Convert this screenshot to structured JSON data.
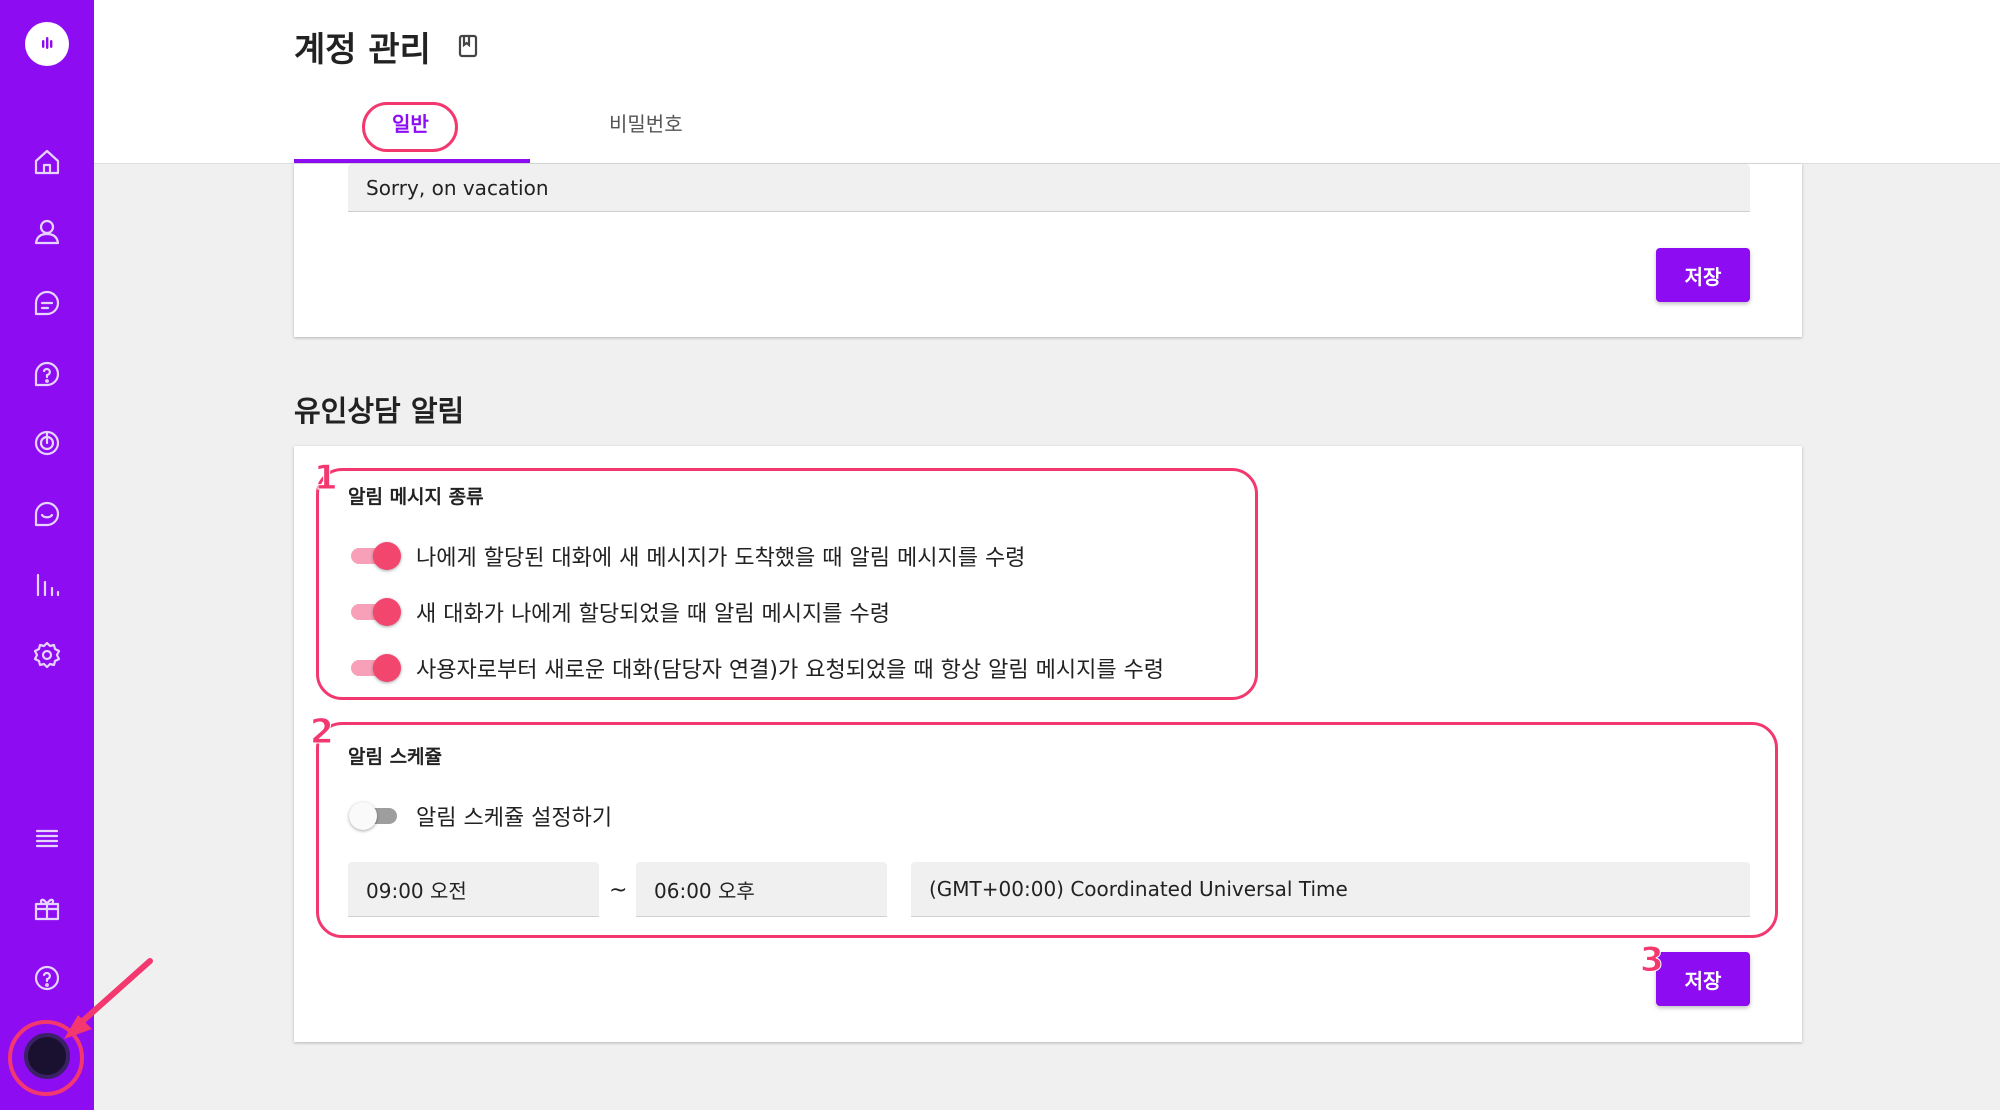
{
  "header": {
    "title": "계정 관리",
    "tabs": [
      {
        "label": "일반",
        "active": true
      },
      {
        "label": "비밀번호",
        "active": false
      }
    ]
  },
  "sidebar": {
    "icons": [
      "logo-icon",
      "home-icon",
      "user-icon",
      "chat-icon",
      "help-icon",
      "target-icon",
      "message-icon",
      "chart-icon",
      "settings-icon",
      "menu-icon",
      "gift-icon",
      "question-icon"
    ]
  },
  "status_card": {
    "status_message": "Sorry, on vacation",
    "save_label": "저장"
  },
  "notification": {
    "section_title": "유인상담 알림",
    "types_label": "알림 메시지 종류",
    "options": [
      {
        "label": "나에게 할당된 대화에 새 메시지가 도착했을 때 알림 메시지를 수령",
        "enabled": true
      },
      {
        "label": "새 대화가 나에게 할당되었을 때 알림 메시지를 수령",
        "enabled": true
      },
      {
        "label": "사용자로부터 새로운 대화(담당자 연결)가 요청되었을 때 항상 알림 메시지를 수령",
        "enabled": true
      }
    ],
    "schedule_label": "알림 스케쥴",
    "schedule_toggle_label": "알림 스케쥴 설정하기",
    "schedule_enabled": false,
    "start_time": "09:00 오전",
    "separator": "~",
    "end_time": "06:00 오후",
    "timezone": "(GMT+00:00) Coordinated Universal Time",
    "save_label": "저장"
  },
  "annotations": {
    "marker_1": "1",
    "marker_2": "2",
    "marker_3": "3"
  },
  "colors": {
    "brand": "#8d0cf2",
    "annotation": "#f2386f",
    "toggle_on": "#f2466e"
  }
}
